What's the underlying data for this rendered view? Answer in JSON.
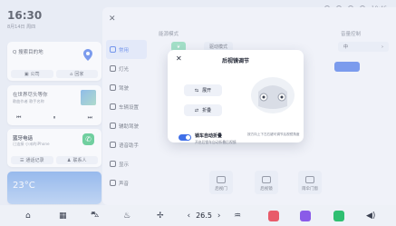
{
  "status": {
    "time": "10:46"
  },
  "left": {
    "clock": "16:30",
    "date": "8月14日 周四",
    "nav": {
      "title": "Q 搜索目的地",
      "btn_company": "公司",
      "btn_home": "回家"
    },
    "music": {
      "title": "在世界尽头等你",
      "artist": "歌曲作者 歌手名称"
    },
    "phone": {
      "title": "蓝牙电话",
      "status": "已连接 小米的iPhone",
      "btn_calls": "通话记录",
      "btn_contacts": "联系人"
    },
    "weather": {
      "temp": "23°C"
    }
  },
  "panel": {
    "menu": [
      "常用",
      "灯光",
      "驾驶",
      "车辆设置",
      "辅助驾驶",
      "语音助手",
      "显示",
      "声音"
    ],
    "section_energy": "能源模式",
    "chip_energy": "驱动模式",
    "section_volume": "音量控制",
    "volume_value": "中",
    "tiles": [
      "后视门",
      "后视镜",
      "雨伞门窗"
    ]
  },
  "dialog": {
    "title": "后视镜调节",
    "btn_unfold": "展开",
    "btn_fold": "折叠",
    "toggle_label": "锁车自动折叠",
    "toggle_desc": "开启后锁车自动折叠后视镜",
    "hint": "按方向上下左右键可调节后视镜角度"
  },
  "dock": {
    "temperature": "26.5"
  }
}
